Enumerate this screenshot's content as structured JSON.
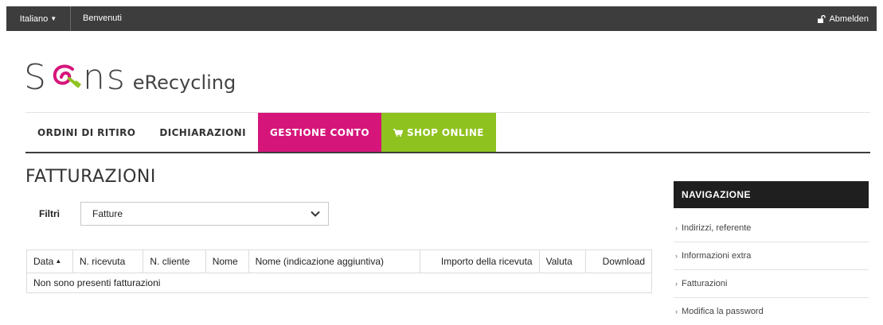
{
  "topbar": {
    "language": "Italiano",
    "welcome": "Benvenuti",
    "logout": "Abmelden"
  },
  "logo": {
    "brand_left": "S",
    "brand_right": "ns",
    "subtitle": "eRecycling",
    "plug_color": "#8ec21f",
    "plug_accent": "#d6157a"
  },
  "nav": {
    "tabs": [
      {
        "label": "ORDINI DI RITIRO"
      },
      {
        "label": "DICHIARAZIONI"
      },
      {
        "label": "GESTIONE CONTO"
      },
      {
        "label": "SHOP ONLINE"
      }
    ],
    "active_color": "#d6157a",
    "shop_color": "#8ec21f"
  },
  "page": {
    "title": "FATTURAZIONI"
  },
  "filter": {
    "label": "Filtri",
    "selected": "Fatture"
  },
  "table": {
    "headers": [
      "Data",
      "N. ricevuta",
      "N. cliente",
      "Nome",
      "Nome (indicazione aggiuntiva)",
      "Importo della ricevuta",
      "Valuta",
      "Download"
    ],
    "empty_message": "Non sono presenti fatturazioni"
  },
  "sidebar": {
    "title": "NAVIGAZIONE",
    "items": [
      {
        "label": "Indirizzi, referente"
      },
      {
        "label": "Informazioni extra"
      },
      {
        "label": "Fatturazioni"
      },
      {
        "label": "Modifica la password"
      }
    ]
  }
}
